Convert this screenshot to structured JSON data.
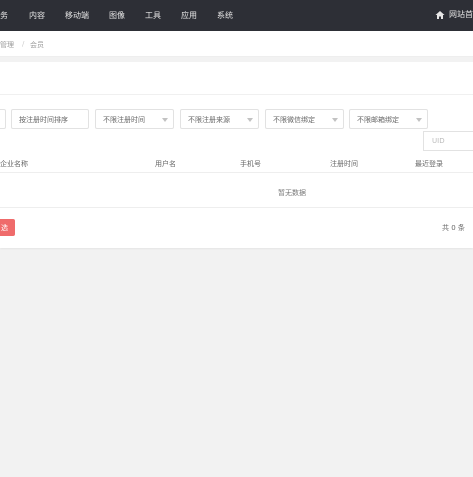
{
  "topnav": {
    "items": [
      "务",
      "内容",
      "移动端",
      "图像",
      "工具",
      "应用",
      "系统"
    ],
    "site_home": "网站首"
  },
  "breadcrumb": {
    "items": [
      "管理",
      "会员"
    ]
  },
  "filters": {
    "sort": "按注册时间排序",
    "reg_time": "不限注册时间",
    "reg_source": "不限注册来源",
    "wechat": "不限微信绑定",
    "email": "不限邮箱绑定",
    "uid_placeholder": "UID"
  },
  "table": {
    "headers": [
      "企业名称",
      "用户名",
      "手机号",
      "注册时间",
      "最近登录"
    ],
    "empty_text": "暂无数据"
  },
  "footer": {
    "red_button": "选",
    "total": "共 0 条"
  },
  "colors": {
    "topbar": "#2d2f36",
    "danger": "#ef6b6b"
  }
}
